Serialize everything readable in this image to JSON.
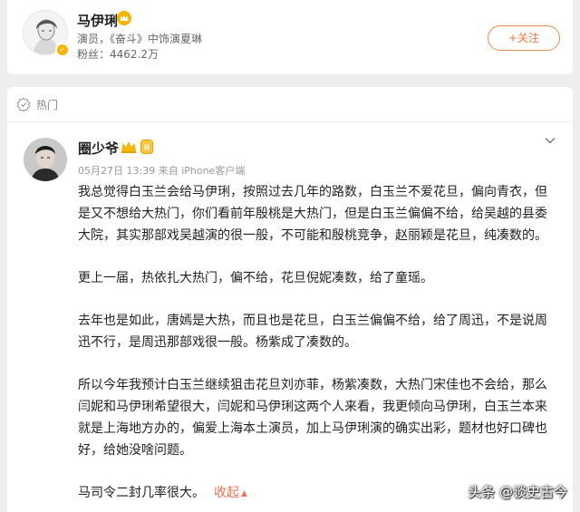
{
  "profile": {
    "name": "马伊琍",
    "description": "演员，《奋斗》中饰演夏琳",
    "fans_label": "粉丝：",
    "fans_count": "4462.2万",
    "follow_label": "+关注"
  },
  "section": {
    "label": "热门"
  },
  "post": {
    "author": "圈少爷",
    "date": "05月27日 13:39",
    "source": "来自 iPhone客户端",
    "level": "II",
    "paragraphs": [
      "我总觉得白玉兰会给马伊琍，按照过去几年的路数，白玉兰不爱花旦，偏向青衣，但是又不想给大热门，你们看前年殷桃是大热门，但是白玉兰偏偏不给，给吴越的县委大院，其实那部戏吴越演的很一般，不可能和殷桃竞争，赵丽颖是花旦，纯凑数的。",
      "更上一届，热依扎大热门，偏不给，花旦倪妮凑数，给了童瑶。",
      "去年也是如此，唐嫣是大热，而且也是花旦，白玉兰偏偏不给，给了周迅，不是说周迅不行，是周迅那部戏很一般。杨紫成了凑数的。",
      "所以今年我预计白玉兰继续狙击花旦刘亦菲，杨紫凑数，大热门宋佳也不会给，那么闫妮和马伊琍希望很大，闫妮和马伊琍这两个人来看，我更倾向马伊琍，白玉兰本来就是上海地方办的，偏爱上海本土演员，加上马伊琍演的确实出彩，题材也好口碑也好，给她没啥问题。",
      "马司令二封几率很大。"
    ],
    "collapse_label": "收起",
    "collapse_arrow": "▲"
  },
  "watermark": "头条 @谈史古今",
  "colors": {
    "accent": "#eb7350",
    "badge_gold": "#f7b500"
  }
}
